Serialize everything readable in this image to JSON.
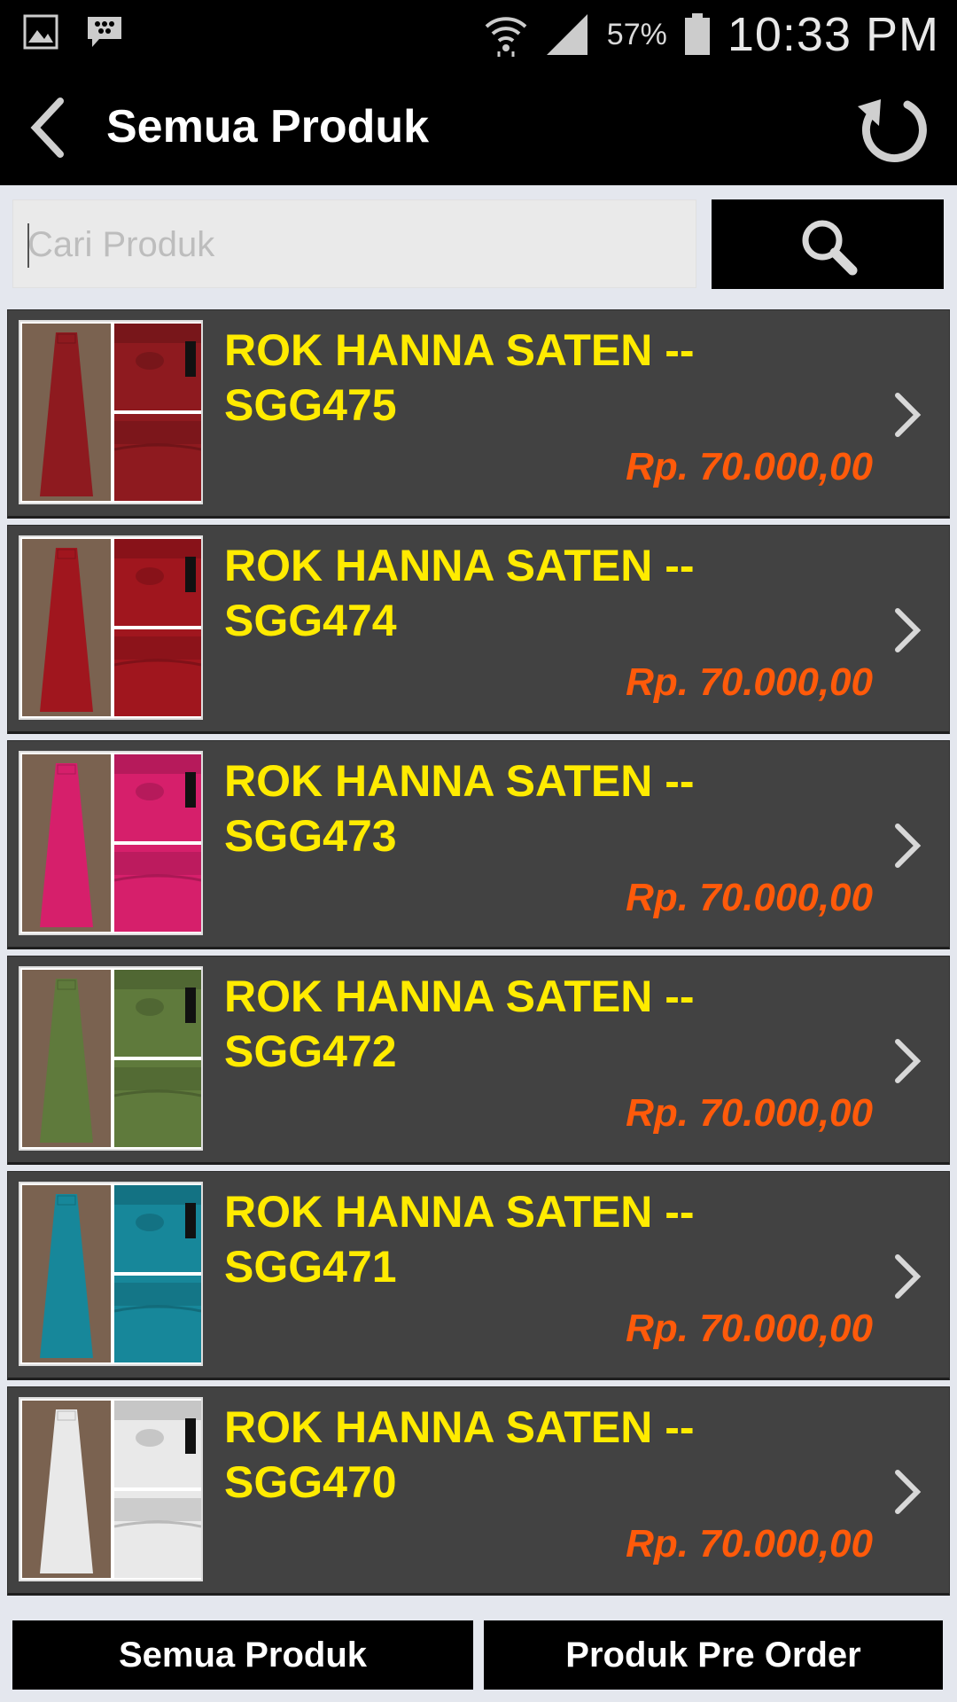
{
  "status_bar": {
    "battery_percent": "57%",
    "time": "10:33 PM",
    "icons": [
      "gallery-icon",
      "bbm-icon",
      "wifi-icon",
      "signal-icon",
      "battery-icon"
    ]
  },
  "app_bar": {
    "title": "Semua Produk",
    "back_icon": "chevron-left-icon",
    "refresh_icon": "refresh-icon"
  },
  "search": {
    "placeholder": "Cari Produk",
    "value": "",
    "button_icon": "search-icon"
  },
  "products": [
    {
      "name": "ROK HANNA SATEN -- SGG475",
      "price": "Rp. 70.000,00",
      "color": "#8e1a1f"
    },
    {
      "name": "ROK HANNA SATEN -- SGG474",
      "price": "Rp. 70.000,00",
      "color": "#a0161e"
    },
    {
      "name": "ROK HANNA SATEN -- SGG473",
      "price": "Rp. 70.000,00",
      "color": "#d61f6b"
    },
    {
      "name": "ROK HANNA SATEN -- SGG472",
      "price": "Rp. 70.000,00",
      "color": "#5f7a3c"
    },
    {
      "name": "ROK HANNA SATEN -- SGG471",
      "price": "Rp. 70.000,00",
      "color": "#17879a"
    },
    {
      "name": "ROK HANNA SATEN -- SGG470",
      "price": "Rp. 70.000,00",
      "color": "#e9e9e9"
    }
  ],
  "bottom_nav": {
    "left_label": "Semua Produk",
    "right_label": "Produk Pre Order"
  },
  "colors": {
    "name_text": "#ffeb00",
    "price_text": "#ff5a0a",
    "item_bg": "#424242",
    "page_bg": "#e4e7ee"
  }
}
